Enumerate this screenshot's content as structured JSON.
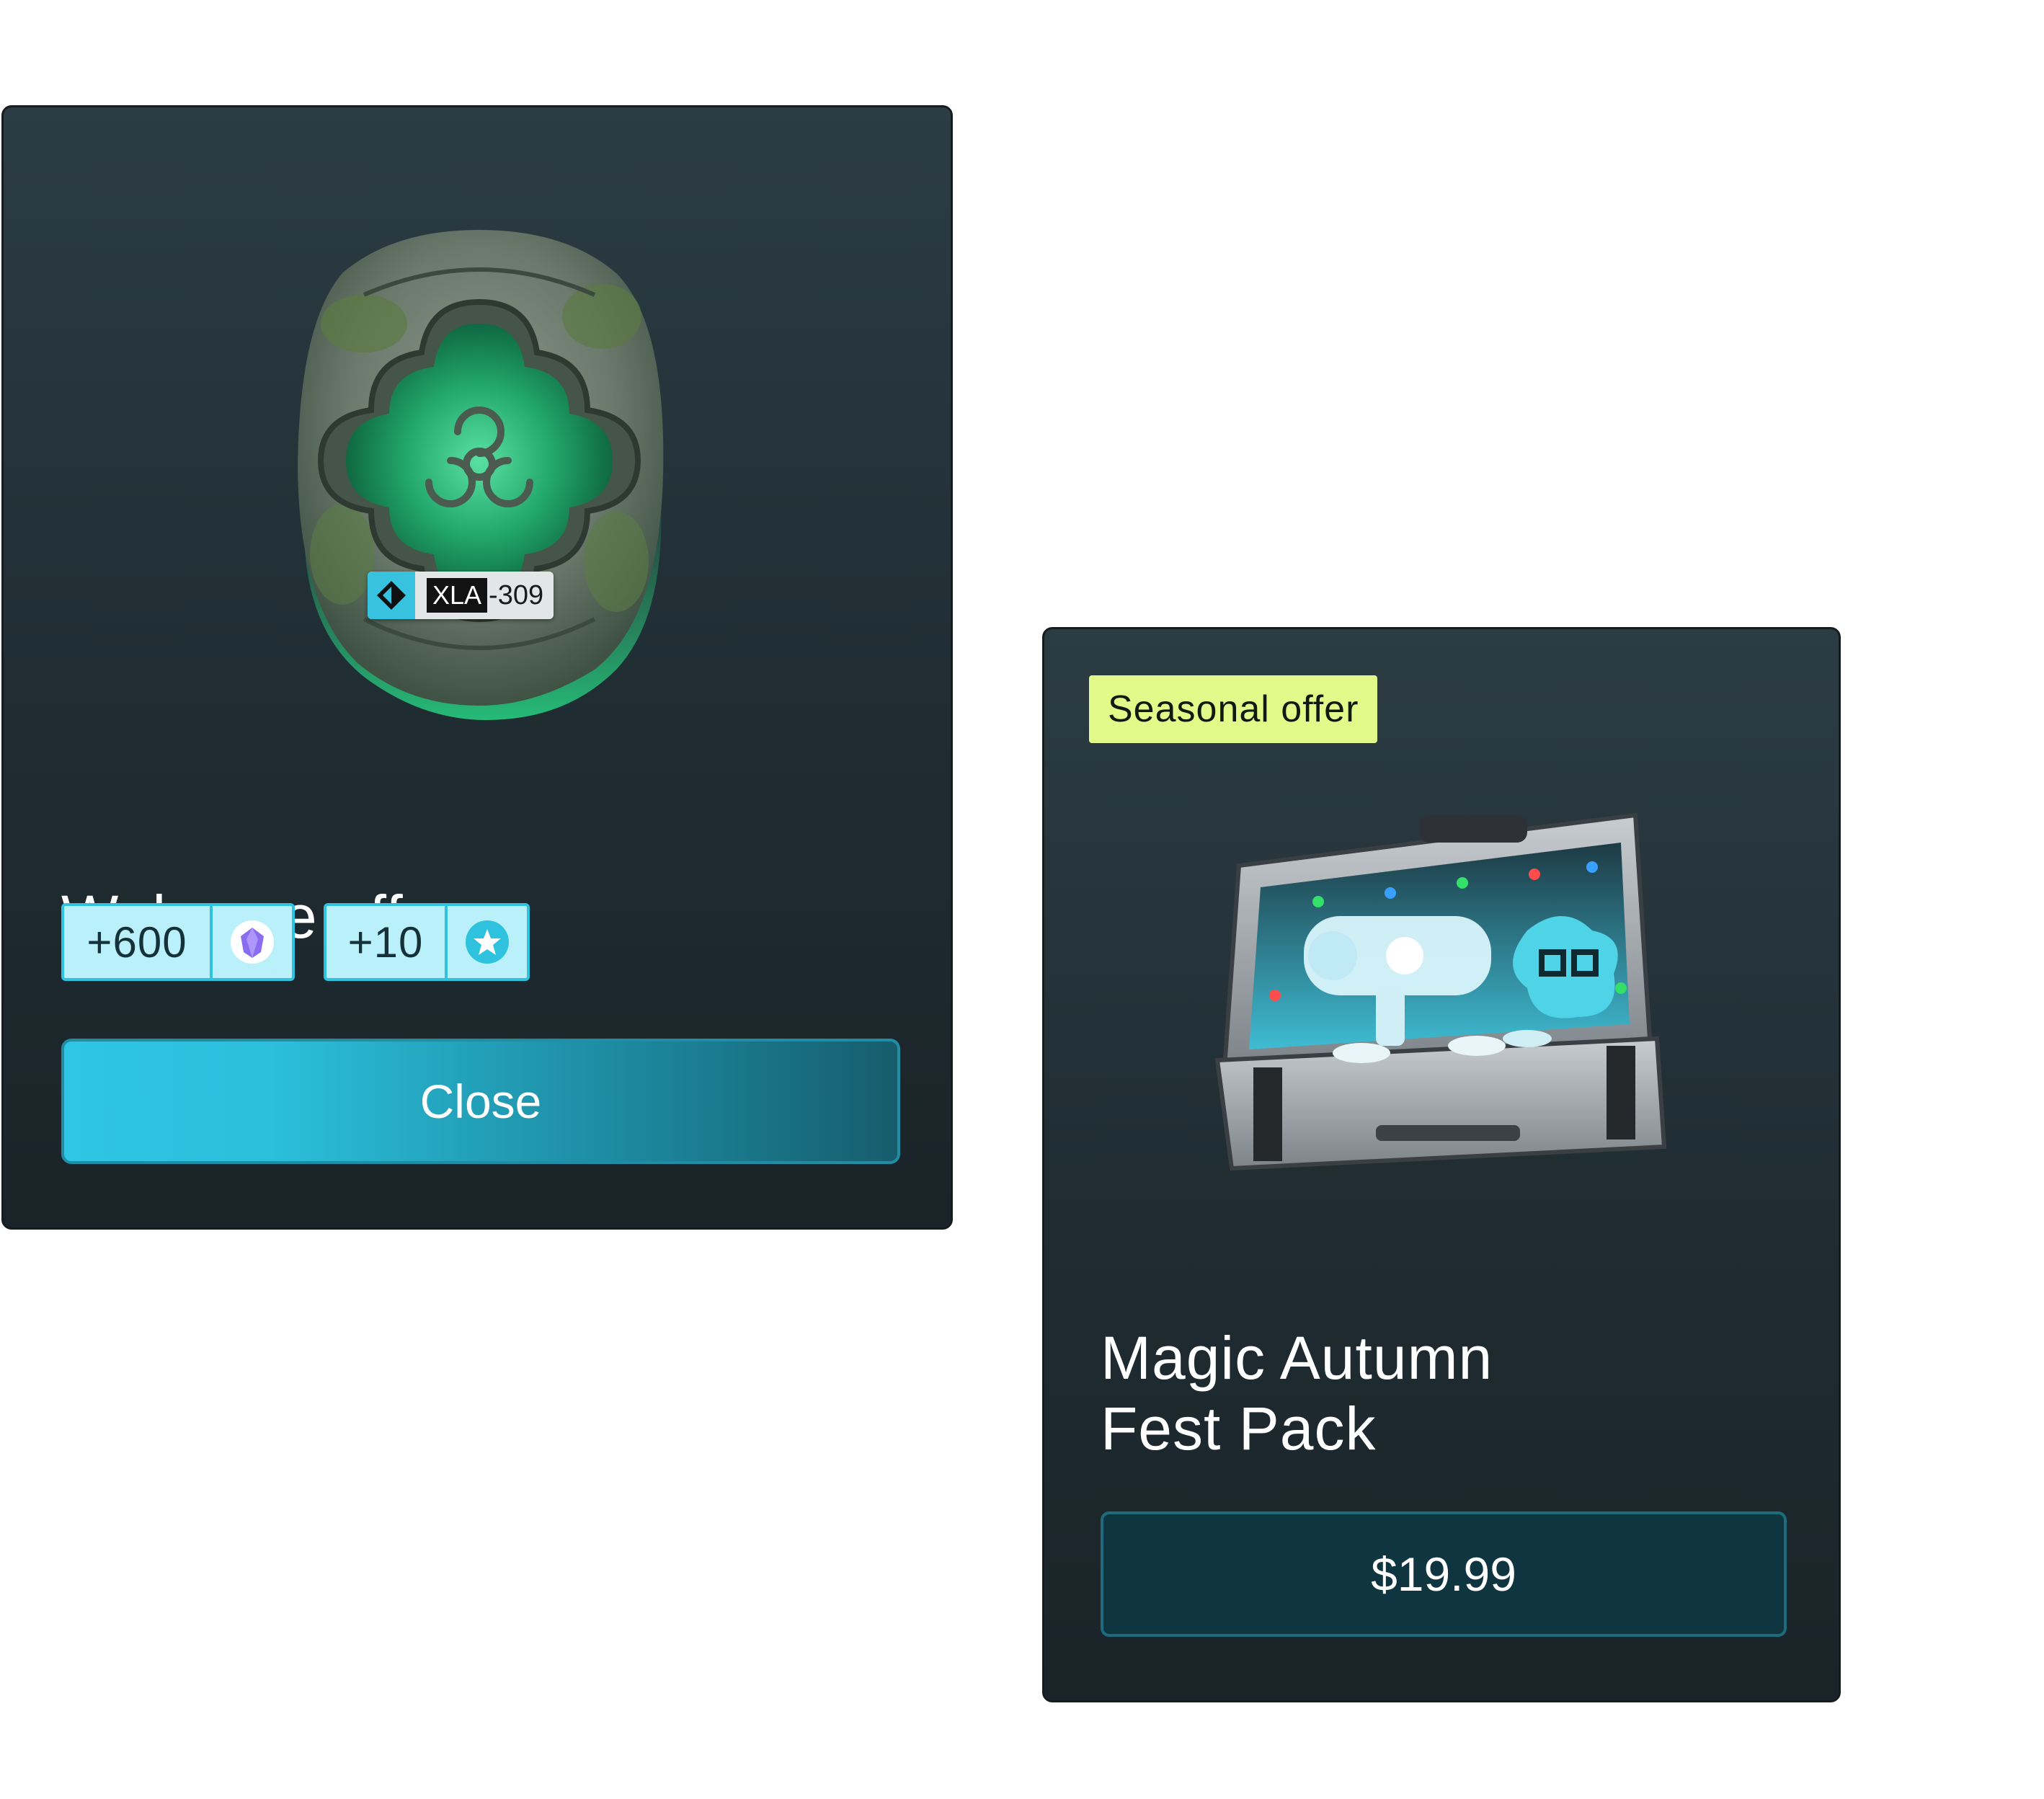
{
  "welcome_card": {
    "title": "Welcome offer",
    "artwork": {
      "icon": "rune-stone-icon",
      "tag_code": "XLA",
      "tag_number": "-309"
    },
    "rewards": [
      {
        "amount": "+600",
        "icon": "gem-icon",
        "icon_color": "#8a6cf0"
      },
      {
        "amount": "+10",
        "icon": "star-badge-icon",
        "icon_color": "#2fc2df"
      }
    ],
    "close_label": "Close"
  },
  "seasonal_card": {
    "badge": "Seasonal offer",
    "artwork": {
      "icon": "toolcase-icon"
    },
    "title_line1": "Magic Autumn",
    "title_line2": "Fest Pack",
    "price_label": "$19.99"
  },
  "colors": {
    "card_bg_top": "#2b3c42",
    "card_bg_bottom": "#1a2328",
    "accent_cyan": "#2ec6e4",
    "reward_bg": "#b9f0fa",
    "badge_bg": "#e1fa8a",
    "price_bg": "#0f3540"
  }
}
